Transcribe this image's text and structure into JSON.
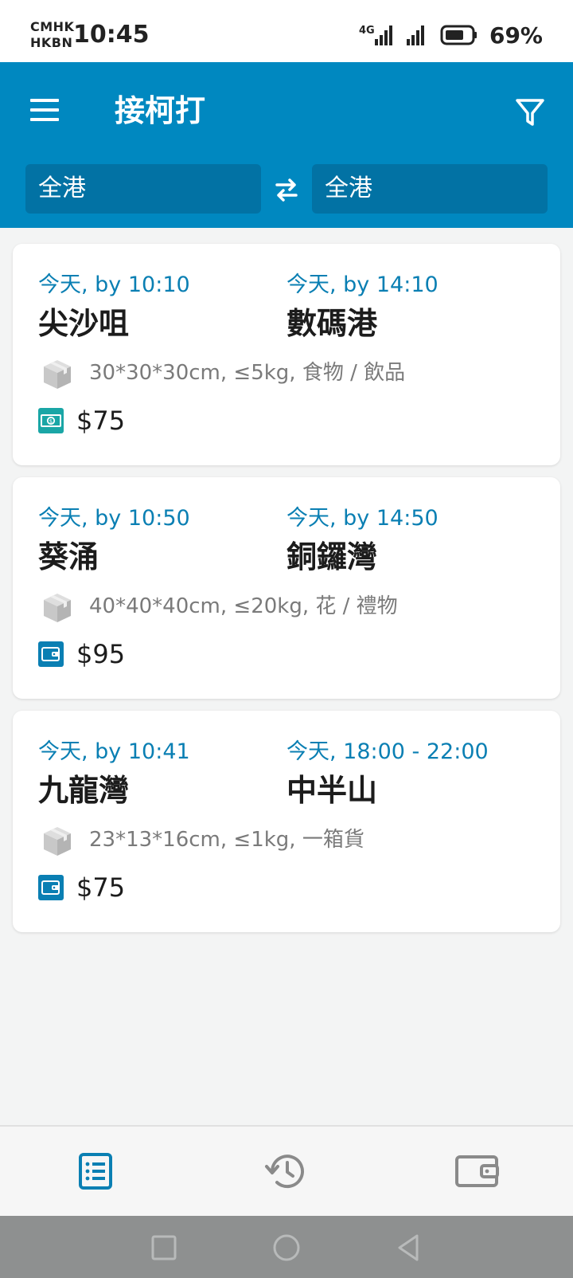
{
  "status_bar": {
    "carrier_line1": "CMHK",
    "carrier_line2": "HKBN",
    "time": "10:45",
    "network_label": "4G",
    "battery": "69%"
  },
  "app_bar": {
    "title": "接柯打",
    "menu_icon": "menu-icon",
    "filter_icon": "filter-icon",
    "from_region": "全港",
    "to_region": "全港",
    "swap_icon": "swap-icon"
  },
  "orders": [
    {
      "pickup_time": "今天, by 10:10",
      "pickup_place": "尖沙咀",
      "dropoff_time": "今天, by 14:10",
      "dropoff_place": "數碼港",
      "package": "30*30*30cm, ≤5kg, 食物 / 飲品",
      "payment_icon": "cash-icon",
      "price": "$75"
    },
    {
      "pickup_time": "今天, by 10:50",
      "pickup_place": "葵涌",
      "dropoff_time": "今天, by 14:50",
      "dropoff_place": "銅鑼灣",
      "package": "40*40*40cm, ≤20kg, 花 / 禮物",
      "payment_icon": "wallet-icon",
      "price": "$95"
    },
    {
      "pickup_time": "今天, by 10:41",
      "pickup_place": "九龍灣",
      "dropoff_time": "今天, 18:00 - 22:00",
      "dropoff_place": "中半山",
      "package": "23*13*16cm, ≤1kg, 一箱貨",
      "payment_icon": "wallet-icon",
      "price": "$75"
    }
  ],
  "bottom_nav": {
    "items": [
      "list-icon",
      "history-icon",
      "wallet-icon"
    ],
    "active": "list-icon"
  },
  "colors": {
    "primary": "#0088c0",
    "primary_dark": "#0272a4",
    "accent_text": "#0a7fb3",
    "cash_icon": "#1aa6a6",
    "wallet_icon": "#0a7fb3",
    "inactive_icon": "#8a8a8a"
  }
}
